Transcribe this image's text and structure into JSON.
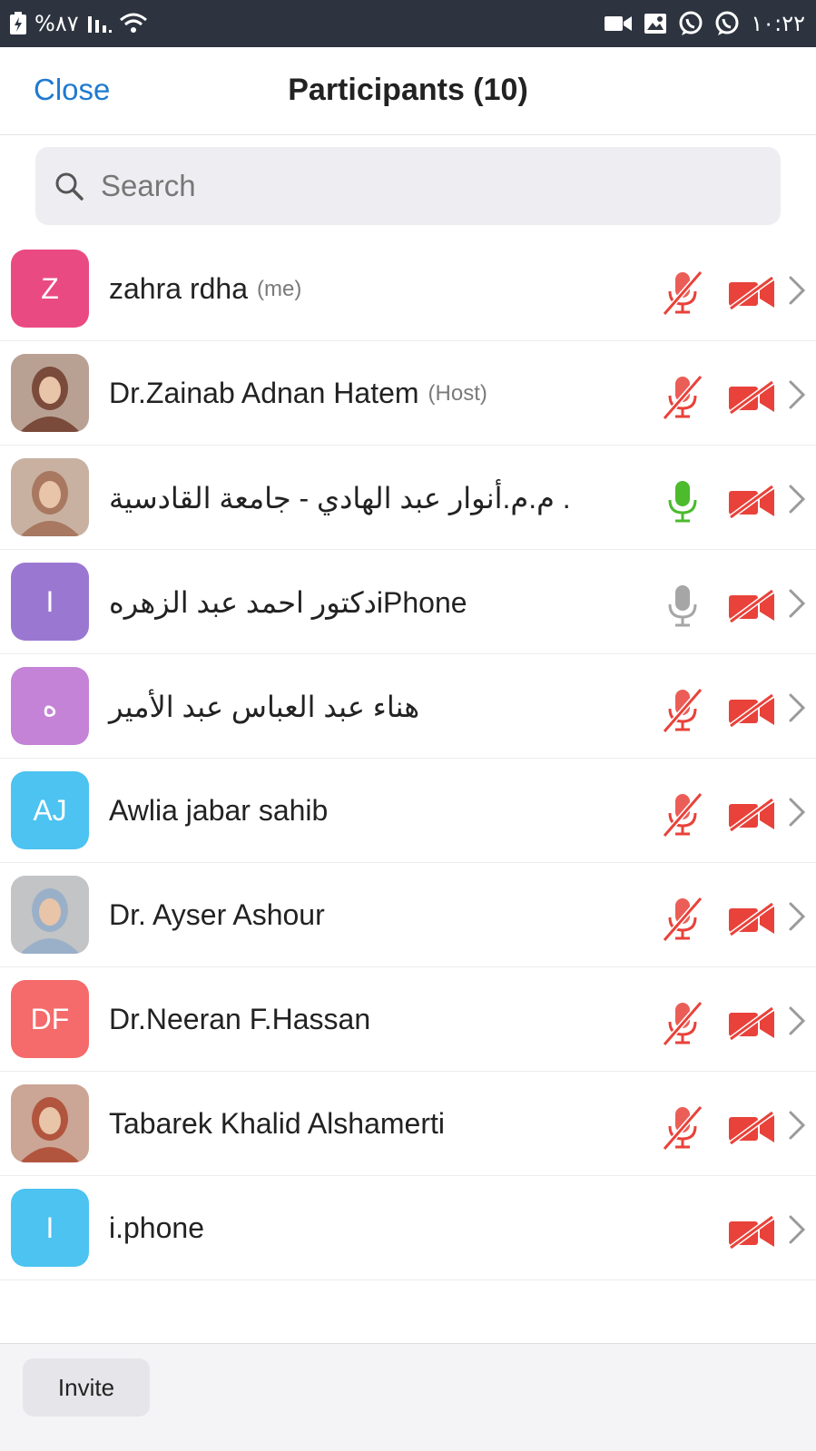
{
  "status_bar": {
    "battery": "%٨٧",
    "time": "١٠:٢٢",
    "icons_left": [
      "charging-icon",
      "signal-icon",
      "wifi-icon"
    ],
    "icons_right": [
      "video-call-icon",
      "gallery-icon",
      "viber-icon",
      "viber-icon"
    ]
  },
  "header": {
    "close_label": "Close",
    "title": "Participants (10)"
  },
  "search": {
    "placeholder": "Search",
    "value": ""
  },
  "participants": [
    {
      "name": "zahra rdha",
      "tag": "(me)",
      "avatar_letter": "Z",
      "avatar_color": "#ea4a82",
      "avatar_photo": false,
      "mic": "muted",
      "video": "off"
    },
    {
      "name": "Dr.Zainab Adnan Hatem",
      "tag": "(Host)",
      "avatar_letter": "",
      "avatar_color": "#7a4a3a",
      "avatar_photo": true,
      "mic": "muted",
      "video": "off"
    },
    {
      "name": "م.م.أنوار عبد الهادي - جامعة القادسية .",
      "tag": "",
      "avatar_letter": "",
      "avatar_color": "#a87860",
      "avatar_photo": true,
      "mic": "active",
      "video": "off"
    },
    {
      "name": "دكتور احمد عبد الزهرهiPhone",
      "tag": "",
      "avatar_letter": "I",
      "avatar_color": "#9a78d2",
      "avatar_photo": false,
      "mic": "idle",
      "video": "off"
    },
    {
      "name": "هناء عبد العباس عبد الأمير",
      "tag": "",
      "avatar_letter": "ه",
      "avatar_color": "#c483d6",
      "avatar_photo": false,
      "mic": "muted",
      "video": "off"
    },
    {
      "name": "Awlia jabar sahib",
      "tag": "",
      "avatar_letter": "AJ",
      "avatar_color": "#4cc3f0",
      "avatar_photo": false,
      "mic": "muted",
      "video": "off"
    },
    {
      "name": "Dr. Ayser Ashour",
      "tag": "",
      "avatar_letter": "",
      "avatar_color": "#9ab0c8",
      "avatar_photo": true,
      "mic": "muted",
      "video": "off"
    },
    {
      "name": "Dr.Neeran F.Hassan",
      "tag": "",
      "avatar_letter": "DF",
      "avatar_color": "#f56a6a",
      "avatar_photo": false,
      "mic": "muted",
      "video": "off"
    },
    {
      "name": "Tabarek Khalid Alshamerti",
      "tag": "",
      "avatar_letter": "",
      "avatar_color": "#b2553e",
      "avatar_photo": true,
      "mic": "muted",
      "video": "off"
    },
    {
      "name": "i.phone",
      "tag": "",
      "avatar_letter": "I",
      "avatar_color": "#4cc3f0",
      "avatar_photo": false,
      "mic": "none",
      "video": "off"
    }
  ],
  "footer": {
    "invite_label": "Invite"
  },
  "colors": {
    "accent_blue": "#1f7ad0",
    "muted_red": "#e8423a",
    "active_green": "#4cbb2c",
    "idle_gray": "#a6a6a6",
    "status_bar": "#2d3440"
  }
}
